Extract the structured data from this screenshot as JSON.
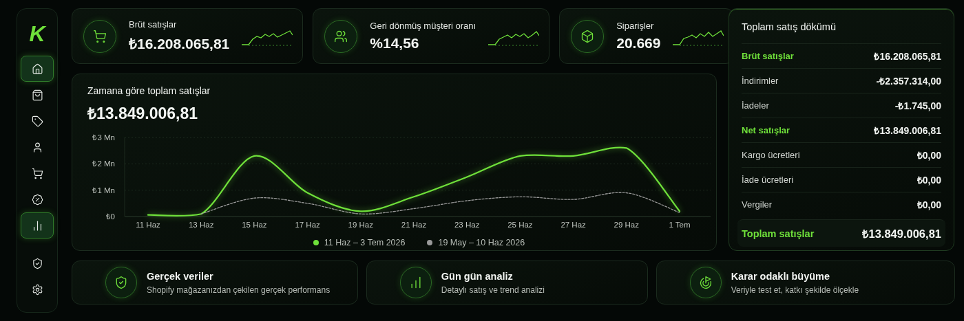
{
  "sidebar": {
    "logo": "K",
    "items": [
      {
        "kind": "home",
        "selected": true
      },
      {
        "kind": "bag",
        "selected": false
      },
      {
        "kind": "tag",
        "selected": false
      },
      {
        "kind": "user",
        "selected": false
      },
      {
        "kind": "cart",
        "selected": false
      },
      {
        "kind": "discount",
        "selected": false
      },
      {
        "kind": "chart",
        "selected": true
      }
    ],
    "bottom_items": [
      {
        "kind": "shield",
        "selected": false
      },
      {
        "kind": "settings",
        "selected": false
      }
    ]
  },
  "metrics": [
    {
      "kind": "cart",
      "label": "Brüt satışlar",
      "value": "₺16.208.065,81"
    },
    {
      "kind": "users",
      "label": "Geri dönmüş müşteri oranı",
      "value": "%14,56"
    },
    {
      "kind": "box",
      "label": "Siparişler",
      "value": "20.669"
    }
  ],
  "sales_chart": {
    "title": "Zamana göre toplam satışlar",
    "value": "₺13.849.006,81",
    "chart_data": {
      "type": "line",
      "x": [
        "11 Haz",
        "13 Haz",
        "15 Haz",
        "17 Haz",
        "19 Haz",
        "21 Haz",
        "23 Haz",
        "25 Haz",
        "27 Haz",
        "29 Haz",
        "1 Tem"
      ],
      "ylim": [
        0,
        3
      ],
      "yticks": [
        {
          "value": 0,
          "label": "₺0"
        },
        {
          "value": 1,
          "label": "₺1 Mn"
        },
        {
          "value": 2,
          "label": "₺2 Mn"
        },
        {
          "value": 3,
          "label": "₺3 Mn"
        }
      ],
      "series": [
        {
          "name": "11 Haz – 3 Tem 2026",
          "color": "#6fe03a",
          "line_style": "solid",
          "values": [
            0.06,
            0.1,
            2.3,
            0.9,
            0.2,
            0.75,
            1.5,
            2.3,
            2.3,
            2.6,
            0.2
          ]
        },
        {
          "name": "19 May – 10 Haz 2026",
          "color": "#9a9a9a",
          "line_style": "dashed",
          "values": [
            null,
            0.1,
            0.7,
            0.5,
            0.1,
            0.3,
            0.6,
            0.75,
            0.65,
            0.9,
            0.15
          ]
        }
      ]
    }
  },
  "breakdown": {
    "title": "Toplam satış dökümü",
    "rows": [
      {
        "kind": "highlight",
        "label": "Brüt satışlar",
        "value": "₺16.208.065,81"
      },
      {
        "kind": "normal",
        "label": "İndirimler",
        "value": "-₺2.357.314,00"
      },
      {
        "kind": "normal",
        "label": "İadeler",
        "value": "-₺1.745,00"
      },
      {
        "kind": "highlight",
        "label": "Net satışlar",
        "value": "₺13.849.006,81"
      },
      {
        "kind": "normal",
        "label": "Kargo ücretleri",
        "value": "₺0,00"
      },
      {
        "kind": "normal",
        "label": "İade ücretleri",
        "value": "₺0,00"
      },
      {
        "kind": "normal",
        "label": "Vergiler",
        "value": "₺0,00"
      },
      {
        "kind": "total",
        "label": "Toplam satışlar",
        "value": "₺13.849.006,81"
      }
    ]
  },
  "features": [
    {
      "kind": "shield",
      "title": "Gerçek veriler",
      "text": "Shopify mağazanızdan çekilen gerçek performans"
    },
    {
      "kind": "bars",
      "title": "Gün gün analiz",
      "text": "Detaylı satış ve trend analizi"
    },
    {
      "kind": "target",
      "title": "Karar odaklı büyüme",
      "text": "Veriyle test et, katkı şekilde ölçekle"
    }
  ]
}
